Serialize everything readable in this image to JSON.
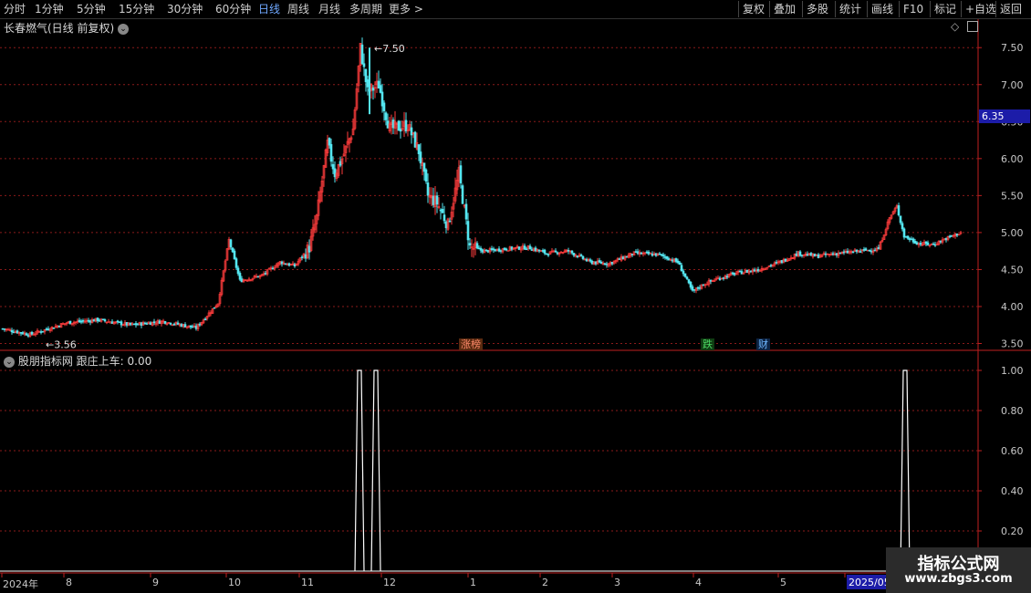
{
  "toolbar": {
    "periods": [
      "分时",
      "1分钟",
      "5分钟",
      "15分钟",
      "30分钟",
      "60分钟",
      "日线",
      "周线",
      "月线",
      "多周期",
      "更多 >"
    ],
    "active_period": "日线",
    "right_buttons": [
      "复权",
      "叠加",
      "多股",
      "统计",
      "画线",
      "F10",
      "标记",
      "+自选",
      "返回"
    ]
  },
  "main_panel": {
    "title": "长春燃气(日线 前复权)",
    "current_price_tag": "6.35",
    "max_label": "7.50",
    "min_label": "3.56",
    "events": [
      {
        "label": "涨榜",
        "color": "#ff6a6a"
      },
      {
        "label": "跌",
        "color": "#4cd964"
      },
      {
        "label": "财",
        "color": "#6fb8ff"
      }
    ]
  },
  "indicator_panel": {
    "title": "股朋指标网 跟庄上车: 0.00"
  },
  "date_axis": [
    "2024年",
    "8",
    "9",
    "10",
    "11",
    "12",
    "1",
    "2",
    "3",
    "4",
    "5",
    "2025/05"
  ],
  "watermark": {
    "line1": "指标公式网",
    "line2": "www.zbgs3.com"
  },
  "colors": {
    "up": "#ff3c3c",
    "down": "#54e6f0",
    "grid": "#8b1a1a",
    "axis": "#c01f1f",
    "price_tag": "#1c1ca8",
    "signal": "#ffffff"
  },
  "chart_data": [
    {
      "type": "candlestick",
      "title": "长春燃气(日线 前复权)",
      "y_ticks": [
        3.5,
        4.0,
        4.5,
        5.0,
        5.5,
        6.0,
        6.5,
        7.0,
        7.5
      ],
      "ylim": [
        3.42,
        7.7
      ],
      "max": 7.5,
      "min": 3.56,
      "last": 6.35,
      "close_path": [
        [
          0,
          3.7
        ],
        [
          15,
          3.62
        ],
        [
          35,
          3.78
        ],
        [
          52,
          3.82
        ],
        [
          70,
          3.75
        ],
        [
          88,
          3.8
        ],
        [
          106,
          3.71
        ],
        [
          118,
          4.05
        ],
        [
          124,
          4.9
        ],
        [
          130,
          4.35
        ],
        [
          142,
          4.42
        ],
        [
          152,
          4.6
        ],
        [
          160,
          4.55
        ],
        [
          168,
          4.8
        ],
        [
          172,
          5.2
        ],
        [
          178,
          6.2
        ],
        [
          182,
          5.8
        ],
        [
          186,
          6.0
        ],
        [
          192,
          6.4
        ],
        [
          196,
          7.5
        ],
        [
          200,
          6.9
        ],
        [
          206,
          7.0
        ],
        [
          212,
          6.4
        ],
        [
          222,
          6.45
        ],
        [
          228,
          6.1
        ],
        [
          233,
          5.5
        ],
        [
          238,
          5.4
        ],
        [
          244,
          5.1
        ],
        [
          250,
          5.8
        ],
        [
          256,
          4.8
        ],
        [
          264,
          4.75
        ],
        [
          276,
          4.78
        ],
        [
          288,
          4.8
        ],
        [
          298,
          4.72
        ],
        [
          310,
          4.75
        ],
        [
          322,
          4.6
        ],
        [
          332,
          4.58
        ],
        [
          346,
          4.72
        ],
        [
          360,
          4.7
        ],
        [
          370,
          4.6
        ],
        [
          378,
          4.2
        ],
        [
          384,
          4.3
        ],
        [
          392,
          4.38
        ],
        [
          402,
          4.45
        ],
        [
          414,
          4.5
        ],
        [
          426,
          4.6
        ],
        [
          436,
          4.72
        ],
        [
          446,
          4.68
        ],
        [
          458,
          4.72
        ],
        [
          470,
          4.75
        ],
        [
          480,
          4.78
        ],
        [
          486,
          5.2
        ],
        [
          490,
          5.35
        ],
        [
          494,
          4.95
        ],
        [
          502,
          4.85
        ],
        [
          510,
          4.84
        ],
        [
          517,
          4.92
        ],
        [
          525,
          5.0
        ]
      ]
    },
    {
      "type": "line",
      "title": "股朋指标网 跟庄上车",
      "y_ticks": [
        0.2,
        0.4,
        0.6,
        0.8,
        1.0
      ],
      "ylim": [
        0,
        1.05
      ],
      "signals": [
        {
          "date_index": 196,
          "value": 1.0
        },
        {
          "date_index": 205,
          "value": 1.0
        },
        {
          "date_index": 495,
          "value": 1.0
        }
      ]
    }
  ]
}
